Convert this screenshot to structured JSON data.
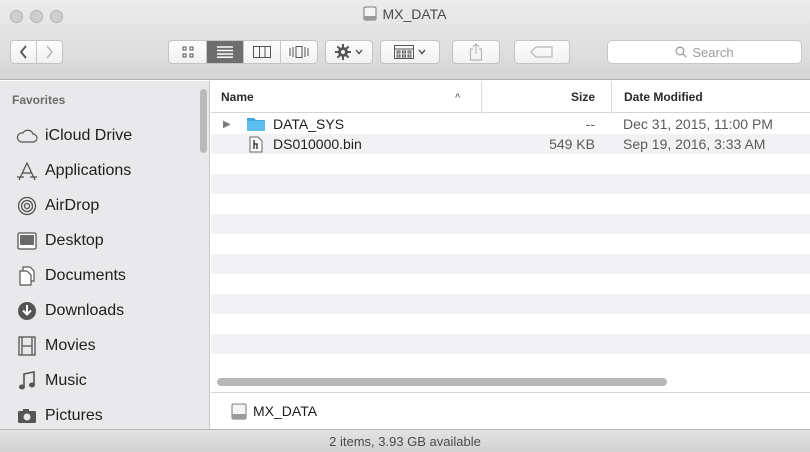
{
  "window": {
    "title": "MX_DATA",
    "title_icon": "external-disk-icon"
  },
  "toolbar": {
    "back_icon": "chevron-left-icon",
    "forward_icon": "chevron-right-icon",
    "views": [
      {
        "name": "icon-view",
        "icon": "grid-icon",
        "active": false
      },
      {
        "name": "list-view",
        "icon": "list-icon",
        "active": true
      },
      {
        "name": "column-view",
        "icon": "columns-icon",
        "active": false
      },
      {
        "name": "cover-flow-view",
        "icon": "coverflow-icon",
        "active": false
      }
    ],
    "action_icon": "gear-icon",
    "arrange_icon": "arrange-icon",
    "share_icon": "share-icon",
    "tag_icon": "tag-icon",
    "search_placeholder": "Search"
  },
  "sidebar": {
    "heading": "Favorites",
    "items": [
      {
        "label": "iCloud Drive",
        "icon": "cloud-icon"
      },
      {
        "label": "Applications",
        "icon": "applications-icon"
      },
      {
        "label": "AirDrop",
        "icon": "airdrop-icon"
      },
      {
        "label": "Desktop",
        "icon": "desktop-icon"
      },
      {
        "label": "Documents",
        "icon": "documents-icon"
      },
      {
        "label": "Downloads",
        "icon": "downloads-icon"
      },
      {
        "label": "Movies",
        "icon": "movies-icon"
      },
      {
        "label": "Music",
        "icon": "music-icon"
      },
      {
        "label": "Pictures",
        "icon": "pictures-icon"
      }
    ]
  },
  "list": {
    "columns": {
      "name": "Name",
      "size": "Size",
      "date": "Date Modified"
    },
    "sort_indicator": "^",
    "files": [
      {
        "name": "DATA_SYS",
        "size": "--",
        "date": "Dec 31, 2015, 11:00 PM",
        "kind": "folder",
        "icon": "folder-icon",
        "disclosure": "▶"
      },
      {
        "name": "DS010000.bin",
        "size": "549 KB",
        "date": "Sep 19, 2016, 3:33 AM",
        "kind": "file",
        "icon": "binary-file-icon",
        "disclosure": ""
      }
    ]
  },
  "pathbar": {
    "label": "MX_DATA",
    "icon": "external-disk-icon"
  },
  "status": {
    "text": "2 items, 3.93 GB available"
  }
}
